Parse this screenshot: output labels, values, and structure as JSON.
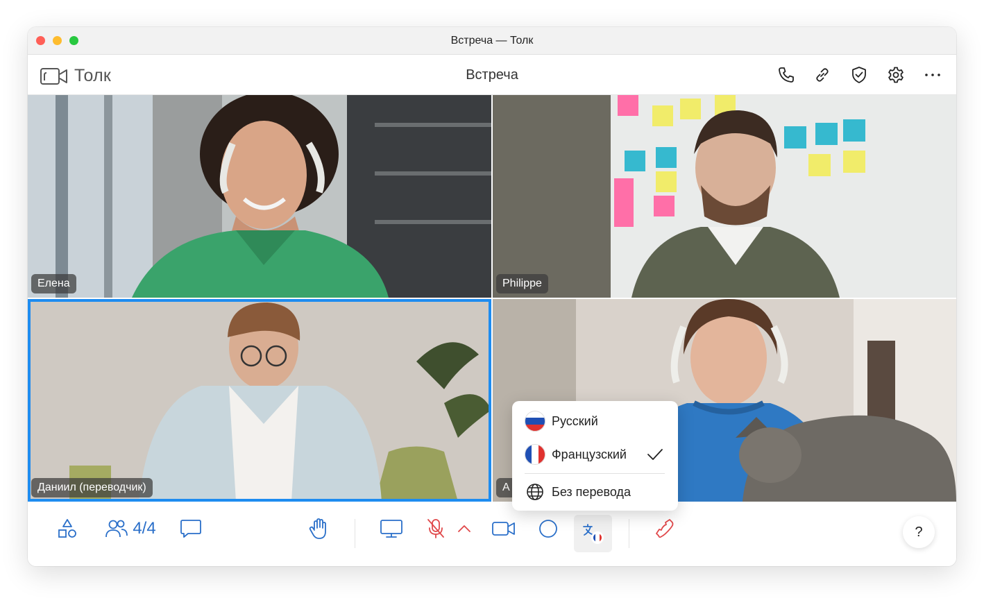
{
  "window": {
    "title": "Встреча — Толк"
  },
  "app": {
    "name": "Толк",
    "meeting_title": "Встреча"
  },
  "header_actions": [
    "phone-icon",
    "link-icon",
    "shield-check-icon",
    "gear-icon",
    "more-icon"
  ],
  "participants": [
    {
      "name": "Елена"
    },
    {
      "name": "Philippe"
    },
    {
      "name": "Даниил (переводчик)",
      "active": true
    },
    {
      "name": "А"
    }
  ],
  "toolbar": {
    "participants_count": "4/4",
    "help_label": "?"
  },
  "translation_menu": {
    "items": [
      {
        "label": "Русский",
        "icon": "russia-flag-icon",
        "selected": false
      },
      {
        "label": "Французский",
        "icon": "france-flag-icon",
        "selected": true
      },
      {
        "label": "Без перевода",
        "icon": "globe-icon",
        "selected": false
      }
    ]
  },
  "colors": {
    "accent": "#1e8cf0",
    "icon_blue": "#2a6fc9",
    "mute_red": "#e0484a"
  }
}
